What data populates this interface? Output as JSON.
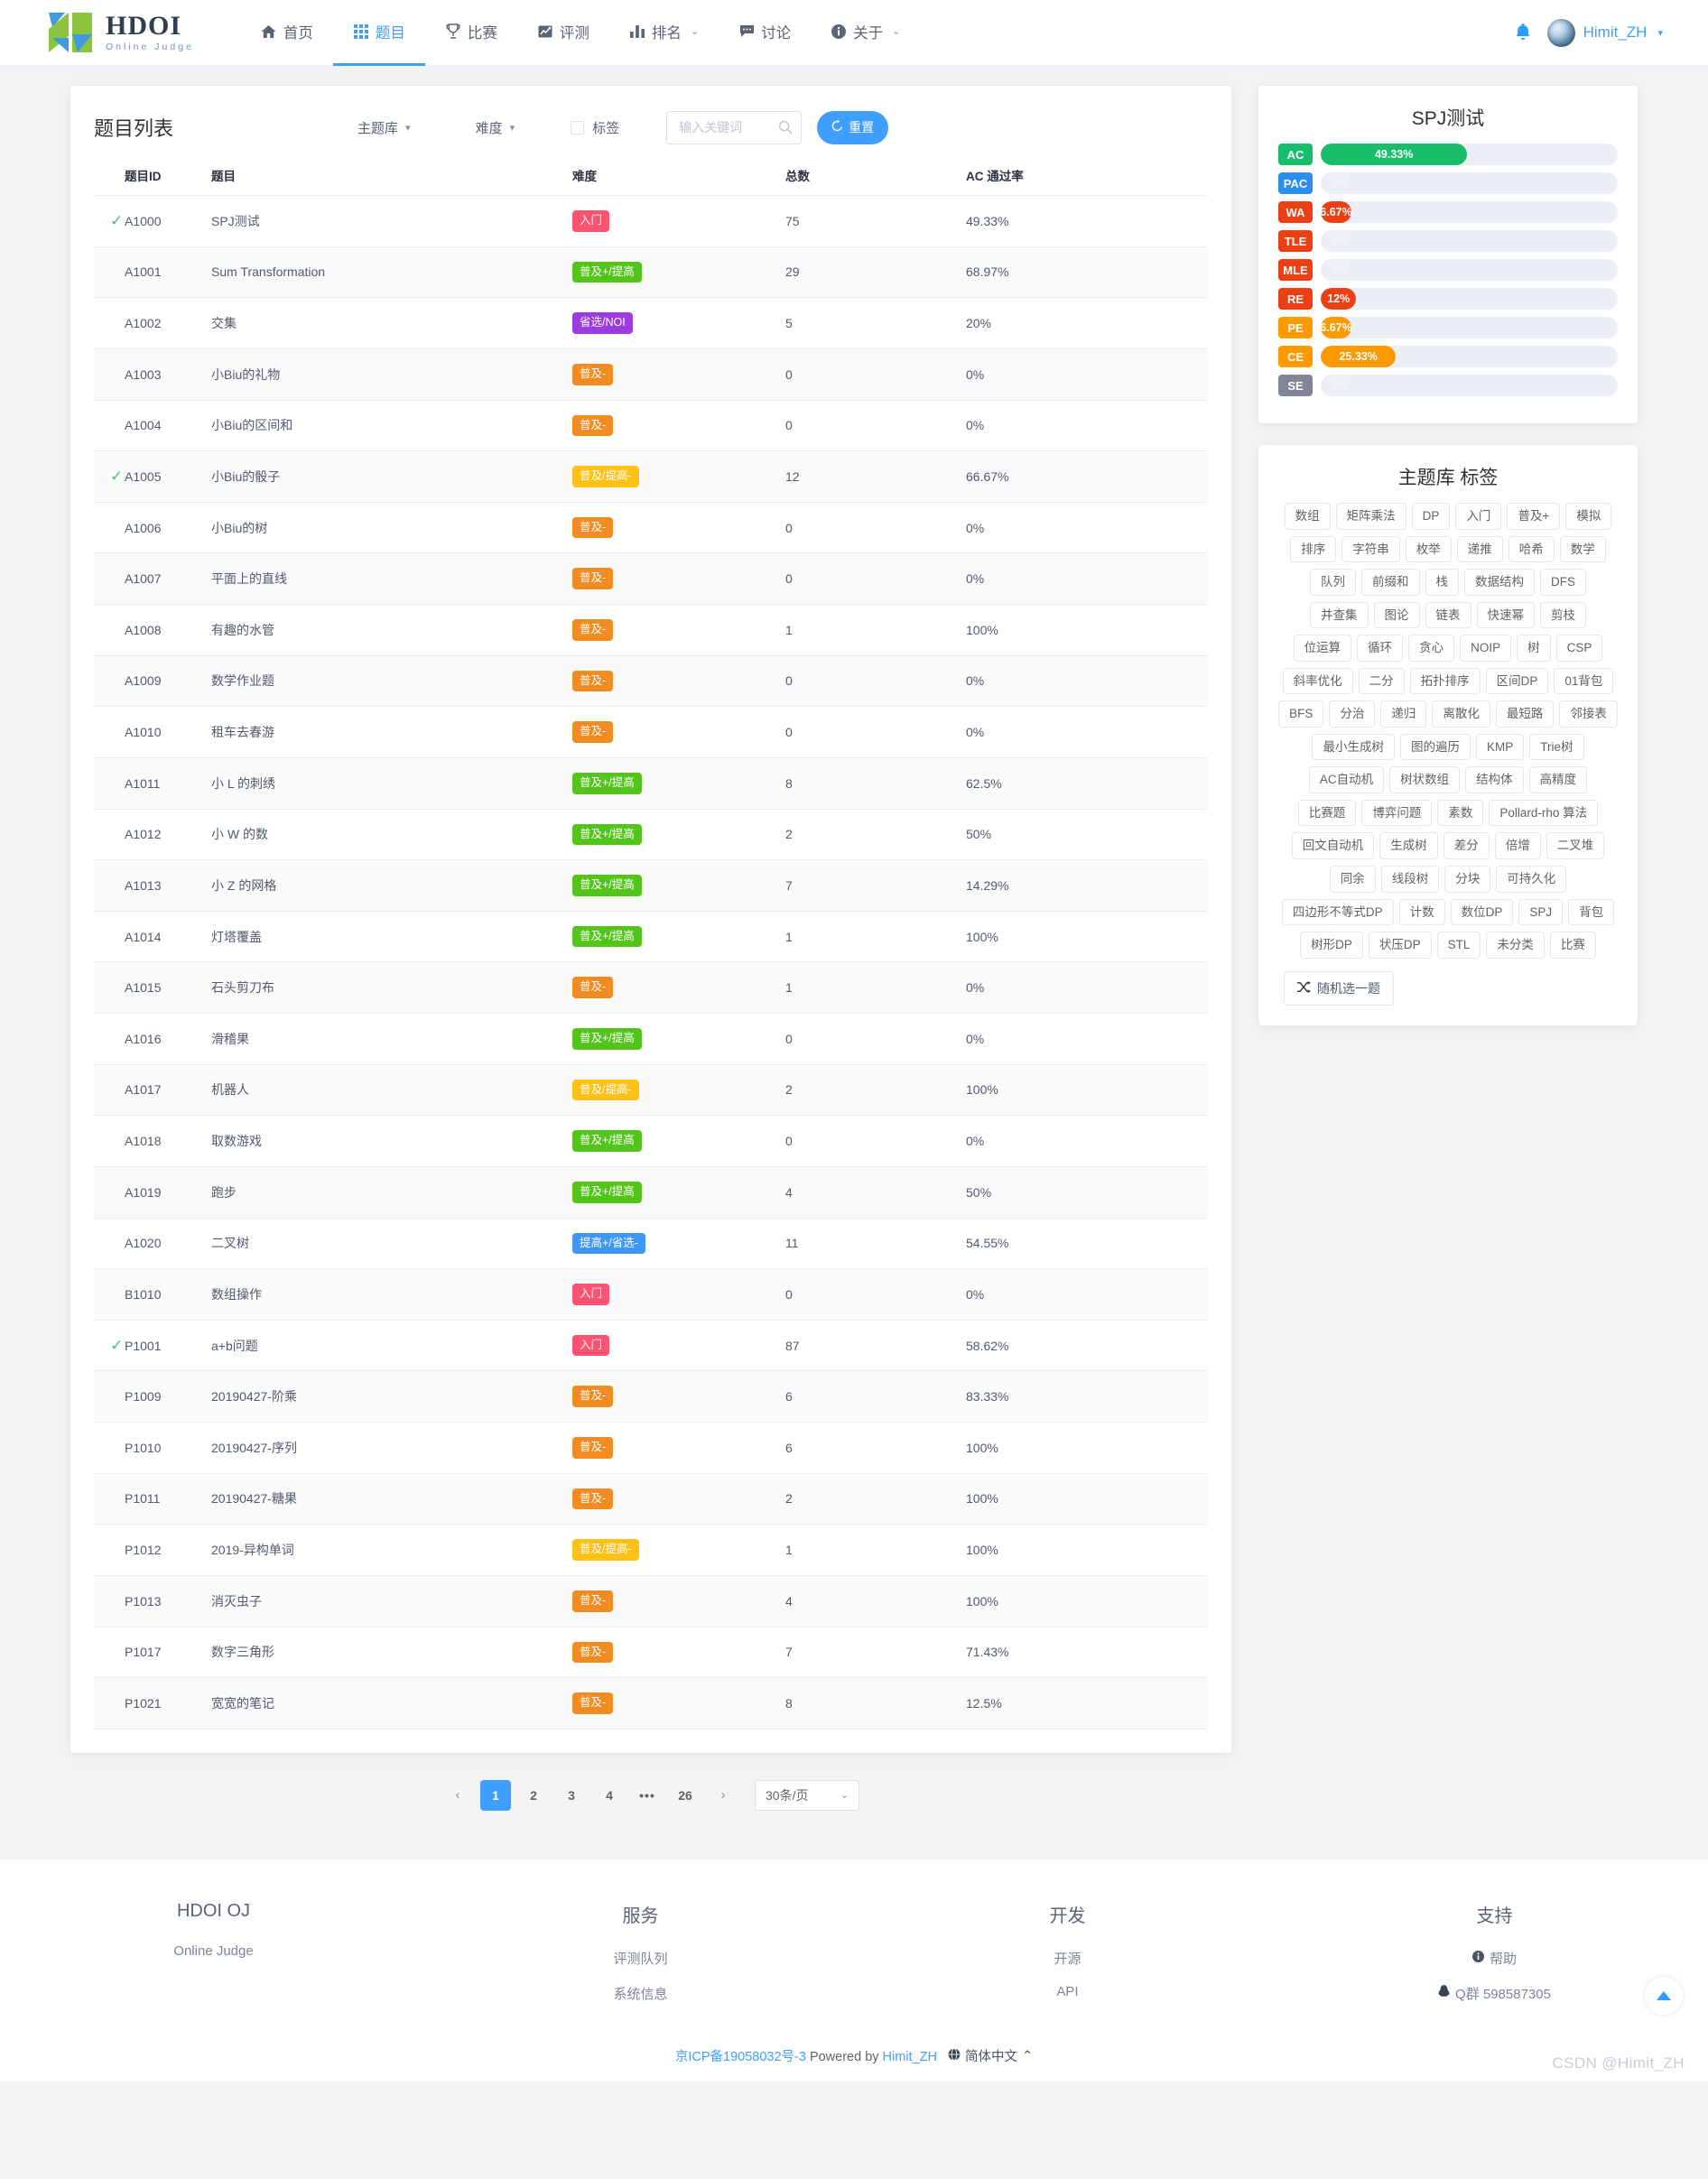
{
  "brand": {
    "title": "HDOI",
    "subtitle": "Online Judge"
  },
  "nav": {
    "items": [
      {
        "label": "首页",
        "icon": "home-icon",
        "active": false,
        "caret": false
      },
      {
        "label": "题目",
        "icon": "grid-icon",
        "active": true,
        "caret": false
      },
      {
        "label": "比赛",
        "icon": "trophy-icon",
        "active": false,
        "caret": false
      },
      {
        "label": "评测",
        "icon": "chart-line-icon",
        "active": false,
        "caret": false
      },
      {
        "label": "排名",
        "icon": "bar-chart-icon",
        "active": false,
        "caret": true
      },
      {
        "label": "讨论",
        "icon": "comment-icon",
        "active": false,
        "caret": true
      },
      {
        "label": "关于",
        "icon": "info-icon",
        "active": false,
        "caret": true
      }
    ],
    "user": "Himit_ZH",
    "accent": "#409eff"
  },
  "problem_list": {
    "title": "题目列表",
    "filters": {
      "theme_label": "主题库",
      "difficulty_label": "难度",
      "tag_label": "标签",
      "search_placeholder": "输入关键词",
      "search_value": "",
      "reset_label": "重置"
    },
    "columns": [
      "题目ID",
      "题目",
      "难度",
      "总数",
      "AC 通过率"
    ],
    "rows": [
      {
        "solved": true,
        "id": "A1000",
        "title": "SPJ测试",
        "difficulty": "入门",
        "diff_class": "tag-ruman",
        "total": "75",
        "rate": "49.33%"
      },
      {
        "solved": false,
        "id": "A1001",
        "title": "Sum Transformation",
        "difficulty": "普及+/提高",
        "diff_class": "tag-pujip",
        "total": "29",
        "rate": "68.97%"
      },
      {
        "solved": false,
        "id": "A1002",
        "title": "交集",
        "difficulty": "省选/NOI",
        "diff_class": "tag-shengxuan",
        "total": "5",
        "rate": "20%"
      },
      {
        "solved": false,
        "id": "A1003",
        "title": "小Biu的礼物",
        "difficulty": "普及-",
        "diff_class": "tag-puji",
        "total": "0",
        "rate": "0%"
      },
      {
        "solved": false,
        "id": "A1004",
        "title": "小Biu的区间和",
        "difficulty": "普及-",
        "diff_class": "tag-puji",
        "total": "0",
        "rate": "0%"
      },
      {
        "solved": true,
        "id": "A1005",
        "title": "小Biu的骰子",
        "difficulty": "普及/提高-",
        "diff_class": "tag-pujitg",
        "total": "12",
        "rate": "66.67%"
      },
      {
        "solved": false,
        "id": "A1006",
        "title": "小Biu的树",
        "difficulty": "普及-",
        "diff_class": "tag-puji",
        "total": "0",
        "rate": "0%"
      },
      {
        "solved": false,
        "id": "A1007",
        "title": "平面上的直线",
        "difficulty": "普及-",
        "diff_class": "tag-puji",
        "total": "0",
        "rate": "0%"
      },
      {
        "solved": false,
        "id": "A1008",
        "title": "有趣的水管",
        "difficulty": "普及-",
        "diff_class": "tag-puji",
        "total": "1",
        "rate": "100%"
      },
      {
        "solved": false,
        "id": "A1009",
        "title": "数学作业题",
        "difficulty": "普及-",
        "diff_class": "tag-puji",
        "total": "0",
        "rate": "0%"
      },
      {
        "solved": false,
        "id": "A1010",
        "title": "租车去春游",
        "difficulty": "普及-",
        "diff_class": "tag-puji",
        "total": "0",
        "rate": "0%"
      },
      {
        "solved": false,
        "id": "A1011",
        "title": "小 L 的刺绣",
        "difficulty": "普及+/提高",
        "diff_class": "tag-pujip",
        "total": "8",
        "rate": "62.5%"
      },
      {
        "solved": false,
        "id": "A1012",
        "title": "小 W 的数",
        "difficulty": "普及+/提高",
        "diff_class": "tag-pujip",
        "total": "2",
        "rate": "50%"
      },
      {
        "solved": false,
        "id": "A1013",
        "title": "小 Z 的网格",
        "difficulty": "普及+/提高",
        "diff_class": "tag-pujip",
        "total": "7",
        "rate": "14.29%"
      },
      {
        "solved": false,
        "id": "A1014",
        "title": "灯塔覆盖",
        "difficulty": "普及+/提高",
        "diff_class": "tag-pujip",
        "total": "1",
        "rate": "100%"
      },
      {
        "solved": false,
        "id": "A1015",
        "title": "石头剪刀布",
        "difficulty": "普及-",
        "diff_class": "tag-puji",
        "total": "1",
        "rate": "0%"
      },
      {
        "solved": false,
        "id": "A1016",
        "title": "滑稽果",
        "difficulty": "普及+/提高",
        "diff_class": "tag-pujip",
        "total": "0",
        "rate": "0%"
      },
      {
        "solved": false,
        "id": "A1017",
        "title": "机器人",
        "difficulty": "普及/提高-",
        "diff_class": "tag-pujitg",
        "total": "2",
        "rate": "100%"
      },
      {
        "solved": false,
        "id": "A1018",
        "title": "取数游戏",
        "difficulty": "普及+/提高",
        "diff_class": "tag-pujip",
        "total": "0",
        "rate": "0%"
      },
      {
        "solved": false,
        "id": "A1019",
        "title": "跑步",
        "difficulty": "普及+/提高",
        "diff_class": "tag-pujip",
        "total": "4",
        "rate": "50%"
      },
      {
        "solved": false,
        "id": "A1020",
        "title": "二叉树",
        "difficulty": "提高+/省选-",
        "diff_class": "tag-tgsx",
        "total": "11",
        "rate": "54.55%"
      },
      {
        "solved": false,
        "id": "B1010",
        "title": "数组操作",
        "difficulty": "入门",
        "diff_class": "tag-ruman",
        "total": "0",
        "rate": "0%"
      },
      {
        "solved": true,
        "id": "P1001",
        "title": "a+b问题",
        "difficulty": "入门",
        "diff_class": "tag-ruman",
        "total": "87",
        "rate": "58.62%"
      },
      {
        "solved": false,
        "id": "P1009",
        "title": "20190427-阶乘",
        "difficulty": "普及-",
        "diff_class": "tag-puji",
        "total": "6",
        "rate": "83.33%"
      },
      {
        "solved": false,
        "id": "P1010",
        "title": "20190427-序列",
        "difficulty": "普及-",
        "diff_class": "tag-puji",
        "total": "6",
        "rate": "100%"
      },
      {
        "solved": false,
        "id": "P1011",
        "title": "20190427-糖果",
        "difficulty": "普及-",
        "diff_class": "tag-puji",
        "total": "2",
        "rate": "100%"
      },
      {
        "solved": false,
        "id": "P1012",
        "title": "2019-异构单词",
        "difficulty": "普及/提高-",
        "diff_class": "tag-pujitg",
        "total": "1",
        "rate": "100%"
      },
      {
        "solved": false,
        "id": "P1013",
        "title": "消灭虫子",
        "difficulty": "普及-",
        "diff_class": "tag-puji",
        "total": "4",
        "rate": "100%"
      },
      {
        "solved": false,
        "id": "P1017",
        "title": "数字三角形",
        "difficulty": "普及-",
        "diff_class": "tag-puji",
        "total": "7",
        "rate": "71.43%"
      },
      {
        "solved": false,
        "id": "P1021",
        "title": "宽宽的笔记",
        "difficulty": "普及-",
        "diff_class": "tag-puji",
        "total": "8",
        "rate": "12.5%"
      }
    ]
  },
  "pagination": {
    "prev": "‹",
    "next": "›",
    "pages": [
      "1",
      "2",
      "3",
      "4",
      "•••",
      "26"
    ],
    "current": "1",
    "page_size": "30条/页"
  },
  "spj_panel": {
    "title": "SPJ测试",
    "chart_data": {
      "type": "bar",
      "title": "SPJ测试",
      "orientation": "horizontal",
      "categories": [
        "AC",
        "PAC",
        "WA",
        "TLE",
        "MLE",
        "RE",
        "PE",
        "CE",
        "SE"
      ],
      "values": [
        49.33,
        0,
        6.67,
        0,
        0,
        12,
        6.67,
        25.33,
        0
      ],
      "labels": [
        "49.33%",
        "0%",
        "6.67%",
        "0%",
        "0%",
        "12%",
        "6.67%",
        "25.33%",
        "0%"
      ],
      "colors": [
        "#19be6b",
        "#2d8cf0",
        "#ed3f14",
        "#ed3f14",
        "#ed3f14",
        "#ed3f14",
        "#ff9900",
        "#ff9900",
        "#808695"
      ],
      "xlabel": "",
      "ylabel": "",
      "xlim": [
        0,
        100
      ],
      "grid": false,
      "legend": false
    },
    "rows": [
      {
        "code": "AC",
        "percent": "49.33%",
        "width": 49.33,
        "color": "#19be6b"
      },
      {
        "code": "PAC",
        "percent": "0%",
        "width": 0,
        "color": "#2d8cf0"
      },
      {
        "code": "WA",
        "percent": "6.67%",
        "width": 6.67,
        "color": "#ed3f14"
      },
      {
        "code": "TLE",
        "percent": "0%",
        "width": 0,
        "color": "#ed3f14"
      },
      {
        "code": "MLE",
        "percent": "0%",
        "width": 0,
        "color": "#ed3f14"
      },
      {
        "code": "RE",
        "percent": "12%",
        "width": 12,
        "color": "#ed3f14"
      },
      {
        "code": "PE",
        "percent": "6.67%",
        "width": 6.67,
        "color": "#ff9900"
      },
      {
        "code": "CE",
        "percent": "25.33%",
        "width": 25.33,
        "color": "#ff9900"
      },
      {
        "code": "SE",
        "percent": "0%",
        "width": 0,
        "color": "#808695"
      }
    ]
  },
  "tag_panel": {
    "title": "主题库 标签",
    "tags": [
      "数组",
      "矩阵乘法",
      "DP",
      "入门",
      "普及+",
      "模拟",
      "排序",
      "字符串",
      "枚举",
      "递推",
      "哈希",
      "数学",
      "队列",
      "前缀和",
      "栈",
      "数据结构",
      "DFS",
      "并查集",
      "图论",
      "链表",
      "快速幂",
      "剪枝",
      "位运算",
      "循环",
      "贪心",
      "NOIP",
      "树",
      "CSP",
      "斜率优化",
      "二分",
      "拓扑排序",
      "区间DP",
      "01背包",
      "BFS",
      "分治",
      "递归",
      "离散化",
      "最短路",
      "邻接表",
      "最小生成树",
      "图的遍历",
      "KMP",
      "Trie树",
      "AC自动机",
      "树状数组",
      "结构体",
      "高精度",
      "比赛题",
      "博弈问题",
      "素数",
      "Pollard-rho 算法",
      "回文自动机",
      "生成树",
      "差分",
      "倍增",
      "二叉堆",
      "同余",
      "线段树",
      "分块",
      "可持久化",
      "四边形不等式DP",
      "计数",
      "数位DP",
      "SPJ",
      "背包",
      "树形DP",
      "状压DP",
      "STL",
      "未分类",
      "比赛"
    ],
    "random_button": "随机选一题"
  },
  "footer": {
    "columns": [
      {
        "heading": "HDOI OJ",
        "links": [
          {
            "label": "Online Judge",
            "icon": ""
          }
        ]
      },
      {
        "heading": "服务",
        "links": [
          {
            "label": "评测队列",
            "icon": ""
          },
          {
            "label": "系统信息",
            "icon": ""
          }
        ]
      },
      {
        "heading": "开发",
        "links": [
          {
            "label": "开源",
            "icon": ""
          },
          {
            "label": "API",
            "icon": ""
          }
        ]
      },
      {
        "heading": "支持",
        "links": [
          {
            "label": "帮助",
            "icon": "info-icon"
          },
          {
            "label": "Q群 598587305",
            "icon": "qq-icon"
          }
        ]
      }
    ],
    "icp": "京ICP备19058032号-3",
    "powered_prefix": "Powered by",
    "powered_by": "Himit_ZH",
    "language": "简体中文",
    "watermark": "CSDN @Himit_ZH"
  }
}
